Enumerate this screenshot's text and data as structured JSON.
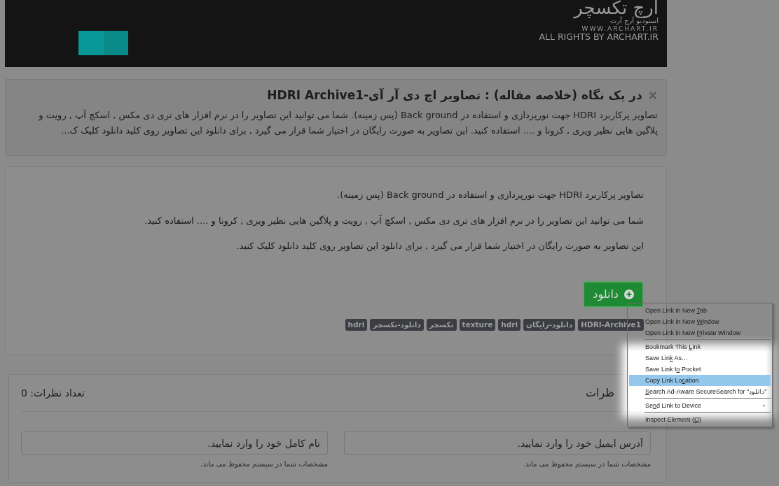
{
  "header": {
    "logo_title": "ارچ تکسچر",
    "logo_subtitle": "استودیو آرچ آرت",
    "website": "WWW.ARCHART.IR",
    "rights": "ALL RIGHTS BY ARCHART.IR"
  },
  "summary": {
    "close": "×",
    "title": "در یک نگاه (خلاصه مقاله) : تصاویر اچ دی آر آی-HDRI Archive1",
    "text": "تصاویر پرکاربرد HDRI جهت نورپردازی و استفاده در Back ground (پس زمینه). شما می توانید این تصاویر را در نرم افزار های تری دی مکس , اسکچ آپ , رویت و پلاگین هایی نظیر ویری , کرونا و .... استفاده کنید. این تصاویر به صورت رایگان در اختیار شما قرار می گیرد , برای دانلود این تصاویر روی کلید دانلود کلیک ک..."
  },
  "article": {
    "paragraphs": [
      "تصاویر پرکاربرد HDRI جهت نورپردازی و استفاده در Back ground (پس زمینه).",
      "شما می توانید این تصاویر را در نرم افزار های تری دی مکس , اسکچ آپ , رویت و پلاگین هایی نظیر ویری , کرونا و .... استفاده کنید.",
      "این تصاویر به صورت رایگان در اختیار شما قرار می گیرد , برای دانلود این تصاویر روی کلید دانلود کلیک کنید."
    ],
    "download_button": "دانلود",
    "tags": [
      "HDRI-Archive1",
      "دانلود-رایگان",
      "hdri",
      "texture",
      "تکسچر",
      "دانلود-تکسچر",
      "hdri"
    ]
  },
  "comments": {
    "title": "ظرات",
    "count_label": "تعداد نظرات:",
    "count": "0",
    "fields": [
      {
        "placeholder": "آدرس ایمیل خود را وارد نمایید.",
        "help": "مشخصات شما در سیستم محفوظ می ماند."
      },
      {
        "placeholder": "نام کامل خود را وارد نمایید.",
        "help": "مشخصات شما در سیستم محفوظ می ماند."
      }
    ]
  },
  "context_menu": [
    {
      "kind": "item",
      "before": "Open Link in New ",
      "key": "T",
      "after": "ab",
      "selected": false
    },
    {
      "kind": "item",
      "before": "Open Link in New ",
      "key": "W",
      "after": "indow",
      "selected": false
    },
    {
      "kind": "item",
      "before": "Open Link in New ",
      "key": "P",
      "after": "rivate Window",
      "selected": false
    },
    {
      "kind": "separator"
    },
    {
      "kind": "item",
      "before": "Bookmark This ",
      "key": "L",
      "after": "ink",
      "selected": false
    },
    {
      "kind": "item",
      "before": "Save Lin",
      "key": "k",
      "after": " As…",
      "selected": false
    },
    {
      "kind": "item",
      "before": "Save Link t",
      "key": "o",
      "after": " Pocket",
      "selected": false
    },
    {
      "kind": "item",
      "before": "Copy Link Lo",
      "key": "c",
      "after": "ation",
      "selected": true
    },
    {
      "kind": "item",
      "key": "S",
      "after": "earch Ad-Aware SecureSearch for \"دانلود\"",
      "selected": false
    },
    {
      "kind": "separator"
    },
    {
      "kind": "item",
      "before": "Se",
      "key": "n",
      "after": "d Link to Device",
      "selected": false,
      "arrow": "›"
    },
    {
      "kind": "separator"
    },
    {
      "kind": "item",
      "before": "Inspect Element (",
      "key": "Q",
      "after": ")",
      "selected": false
    }
  ]
}
